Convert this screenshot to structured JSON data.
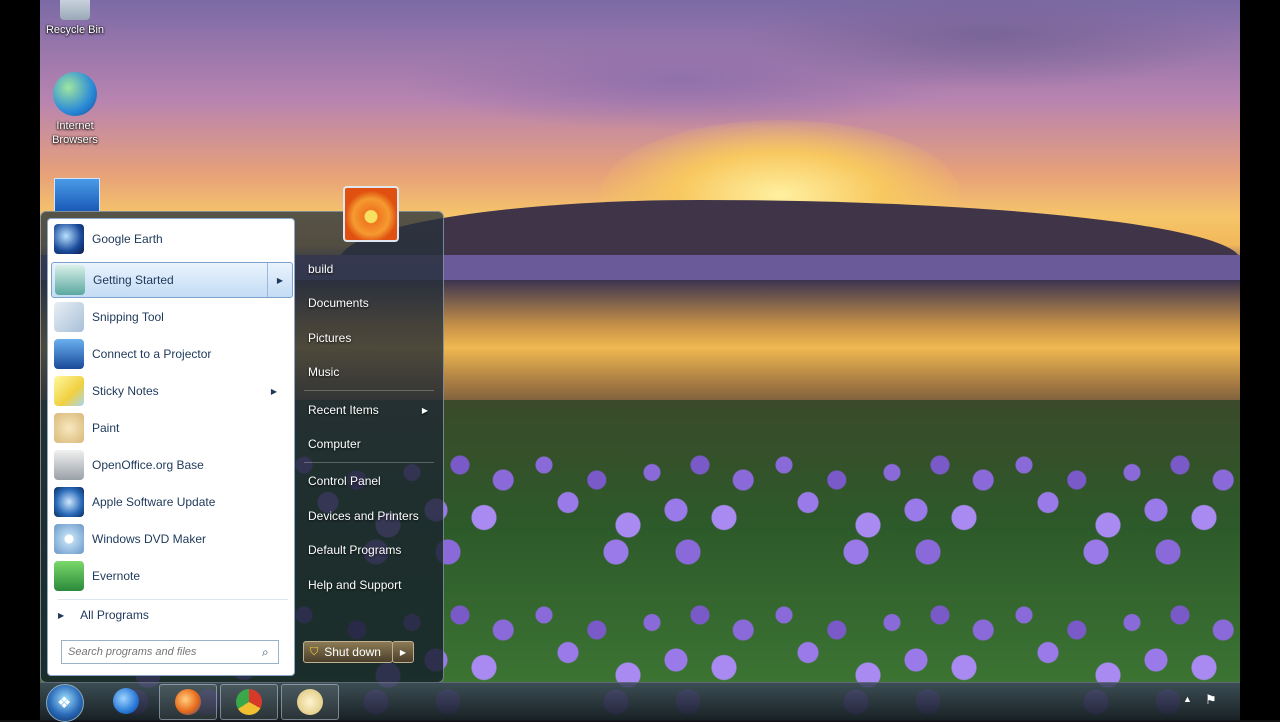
{
  "desktop": {
    "icons": [
      {
        "label": "Recycle Bin"
      },
      {
        "label": "Internet Browsers"
      }
    ]
  },
  "start_menu": {
    "programs": [
      {
        "label": "Google Earth",
        "icon": "google-earth-icon",
        "submenu": false
      },
      {
        "label": "Getting Started",
        "icon": "getting-started-icon",
        "submenu": true,
        "highlighted": true
      },
      {
        "label": "Snipping Tool",
        "icon": "scissors-icon",
        "submenu": false
      },
      {
        "label": "Connect to a Projector",
        "icon": "projector-icon",
        "submenu": false
      },
      {
        "label": "Sticky Notes",
        "icon": "sticky-notes-icon",
        "submenu": true
      },
      {
        "label": "Paint",
        "icon": "paint-palette-icon",
        "submenu": false
      },
      {
        "label": "OpenOffice.org Base",
        "icon": "database-icon",
        "submenu": false
      },
      {
        "label": "Apple Software Update",
        "icon": "software-update-icon",
        "submenu": false
      },
      {
        "label": "Windows DVD Maker",
        "icon": "dvd-icon",
        "submenu": false
      },
      {
        "label": "Evernote",
        "icon": "evernote-elephant-icon",
        "submenu": false
      }
    ],
    "all_programs": "All Programs",
    "search_placeholder": "Search programs and files",
    "right_items": [
      {
        "label": "build",
        "submenu": false
      },
      {
        "label": "Documents",
        "submenu": false
      },
      {
        "label": "Pictures",
        "submenu": false
      },
      {
        "label": "Music",
        "submenu": false
      },
      {
        "label": "Recent Items",
        "submenu": true
      },
      {
        "label": "Computer",
        "submenu": false
      },
      {
        "label": "Control Panel",
        "submenu": false
      },
      {
        "label": "Devices and Printers",
        "submenu": false
      },
      {
        "label": "Default Programs",
        "submenu": false
      },
      {
        "label": "Help and Support",
        "submenu": false
      }
    ],
    "shutdown_label": "Shut down"
  },
  "taskbar": {
    "pinned": [
      {
        "icon": "internet-explorer-icon",
        "color": "#2a7ad8"
      },
      {
        "icon": "firefox-icon",
        "color": "#e86a1a"
      },
      {
        "icon": "chrome-icon",
        "color": "#3aa84a"
      },
      {
        "icon": "paint-icon",
        "color": "#d8c070"
      }
    ]
  },
  "colors": {
    "menu_text": "#1e395b",
    "highlight": "#c3dcf5"
  }
}
